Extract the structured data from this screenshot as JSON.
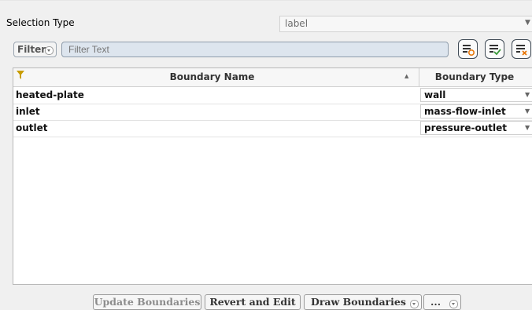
{
  "selection": {
    "label": "Selection Type",
    "value": "label"
  },
  "filter": {
    "button_label": "Filter",
    "placeholder": "Filter Text"
  },
  "table": {
    "columns": [
      "Boundary Name",
      "Boundary Type"
    ],
    "rows": [
      {
        "name": "heated-plate",
        "type": "wall"
      },
      {
        "name": "inlet",
        "type": "mass-flow-inlet"
      },
      {
        "name": "outlet",
        "type": "pressure-outlet"
      }
    ]
  },
  "buttons": {
    "update": "Update Boundaries",
    "revert": "Revert and Edit",
    "draw": "Draw Boundaries",
    "more": "..."
  },
  "colors": {
    "filter_funnel": "#c89c00",
    "tool_accent_orange": "#e8780c",
    "tool_accent_green": "#3a9a3a"
  }
}
